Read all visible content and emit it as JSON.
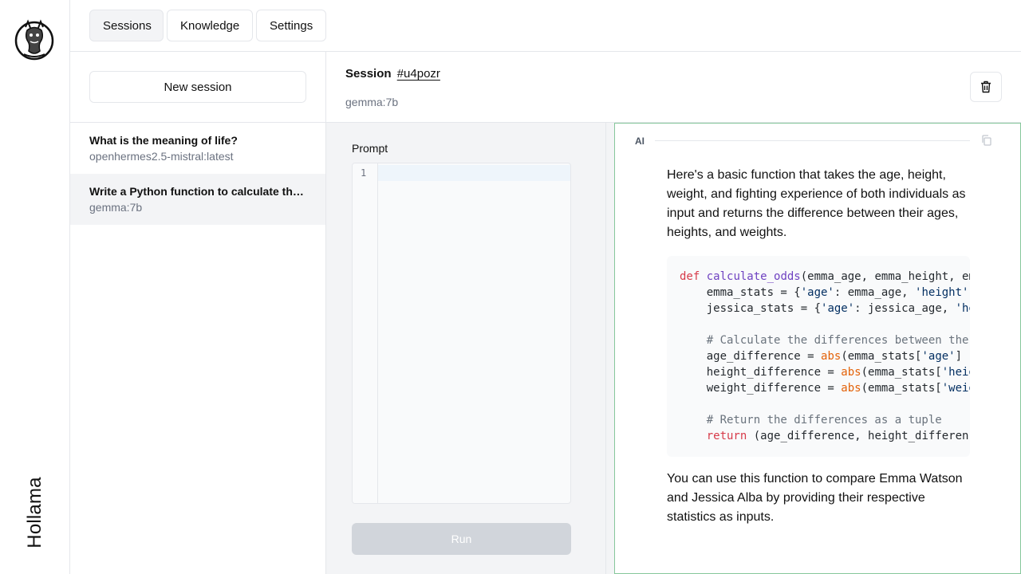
{
  "app": {
    "name": "Hollama"
  },
  "nav": {
    "tabs": [
      "Sessions",
      "Knowledge",
      "Settings"
    ]
  },
  "sidebar": {
    "new_session_label": "New session",
    "sessions": [
      {
        "title": "What is the meaning of life?",
        "model": "openhermes2.5-mistral:latest"
      },
      {
        "title": "Write a Python function to calculate the odds",
        "model": "gemma:7b"
      }
    ]
  },
  "session": {
    "heading": "Session",
    "id": "#u4pozr",
    "model": "gemma:7b"
  },
  "prompt": {
    "label": "Prompt",
    "line_number": "1",
    "run_label": "Run"
  },
  "response": {
    "role": "AI",
    "intro": "Here's a basic function that takes the age, height, weight, and fighting experience of both individuals as input and returns the difference between their ages, heights, and weights.",
    "outro": "You can use this function to compare Emma Watson and Jessica Alba by providing their respective statistics as inputs.",
    "code": {
      "l1_kw": "def",
      "l1_fn": "calculate_odds",
      "l1_rest": "(emma_age, emma_height, em",
      "l2_a": "    emma_stats = {",
      "l2_s1": "'age'",
      "l2_b": ": emma_age, ",
      "l2_s2": "'height'",
      "l3_a": "    jessica_stats = {",
      "l3_s1": "'age'",
      "l3_b": ": jessica_age, ",
      "l3_s2": "'he",
      "l5_cm": "    # Calculate the differences between the",
      "l6_a": "    age_difference = ",
      "l6_bi": "abs",
      "l6_b": "(emma_stats[",
      "l6_s": "'age'",
      "l6_c": "] -",
      "l7_a": "    height_difference = ",
      "l7_bi": "abs",
      "l7_b": "(emma_stats[",
      "l7_s": "'heig",
      "l8_a": "    weight_difference = ",
      "l8_bi": "abs",
      "l8_b": "(emma_stats[",
      "l8_s": "'weig",
      "l10_cm": "    # Return the differences as a tuple",
      "l11_a": "    ",
      "l11_kw": "return",
      "l11_b": " (age_difference, height_differen"
    }
  },
  "colors": {
    "accent_border": "#86c79b",
    "panel_bg": "#f3f4f6",
    "run_disabled": "#d1d5db"
  },
  "icons": {
    "logo": "llama-logo-icon",
    "delete": "trash-icon",
    "copy": "copy-icon"
  }
}
